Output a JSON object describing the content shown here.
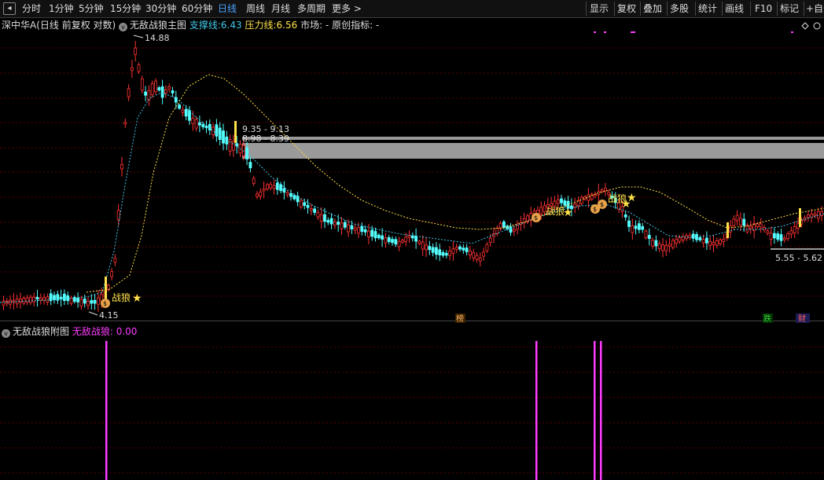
{
  "toolbar": {
    "back_icon": "back-arrow-icon",
    "periods": [
      "分时",
      "1分钟",
      "5分钟",
      "15分钟",
      "30分钟",
      "60分钟",
      "日线",
      "周线",
      "月线",
      "多周期",
      "更多 >"
    ],
    "active_period": "日线",
    "right_buttons": [
      "显示",
      "复权",
      "叠加",
      "多股",
      "统计",
      "画线",
      "F10",
      "标记",
      "+自选"
    ]
  },
  "main_legend": {
    "stock": "深中华A(日线 前复权 对数)",
    "indicator": "无敌战狼主图",
    "support_label": "支撑线:",
    "support_value": "6.43",
    "pressure_label": "压力线:",
    "pressure_value": "6.56",
    "market_label": "市场: -",
    "original_label": "原创指标: -"
  },
  "sub_legend": {
    "indicator": "无敌战狼附图",
    "series_label": "无敌战狼:",
    "series_value": "0.00"
  },
  "annotations": {
    "high": "14.88",
    "low": "4.15",
    "zone_upper": "9.35 - 9.13",
    "zone_lower": "8.98 - 8.39",
    "zone_right": "5.55 - 5.62",
    "signal_text": "战狼",
    "signal_icon": "money-bag-icon",
    "star_icon": "star-icon"
  },
  "markers": [
    {
      "text": "榜",
      "color": "#ffb060"
    },
    {
      "text": "跌",
      "color": "#3ccf3c"
    },
    {
      "text": "财",
      "color": "#ff6060"
    }
  ],
  "colors": {
    "up": "#ff3232",
    "down": "#54ffff",
    "support": "#43c6e8",
    "pressure": "#ffe14a",
    "signal": "#ff3cff",
    "zone": "#9a9a9a",
    "grid": "#5a0000"
  },
  "chart_data": {
    "type": "candlestick",
    "price_high": 14.88,
    "price_low": 4.15,
    "sub_values_peaks": [
      {
        "position": "spike-1",
        "value": 1
      },
      {
        "position": "spike-2",
        "value": 1
      },
      {
        "position": "spike-3",
        "value": 1
      },
      {
        "position": "spike-4",
        "value": 1
      }
    ]
  }
}
